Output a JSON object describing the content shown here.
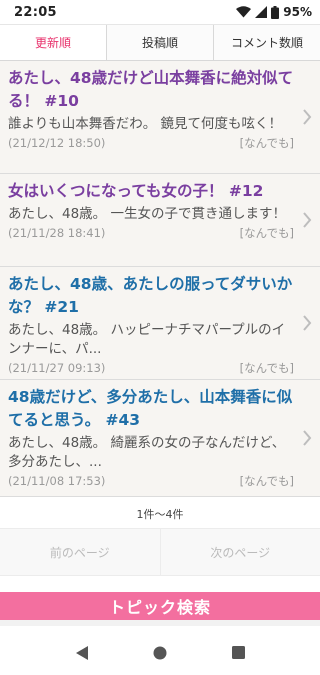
{
  "status": {
    "time": "22:05",
    "battery": "95%"
  },
  "tabs": [
    {
      "label": "更新順",
      "active": true
    },
    {
      "label": "投稿順",
      "active": false
    },
    {
      "label": "コメント数順",
      "active": false
    }
  ],
  "topics": [
    {
      "title": "あたし、48歳だけど山本舞香に絶対似てる！ #10",
      "excerpt": "誰よりも山本舞香だわ。 鏡見て何度も呟く！",
      "date": "(21/12/12 18:50)",
      "category": "[なんでも]"
    },
    {
      "title": "女はいくつになっても女の子！ #12",
      "excerpt": "あたし、48歳。 一生女の子で貫き通します！",
      "date": "(21/11/28 18:41)",
      "category": "[なんでも]"
    },
    {
      "title": "あたし、48歳、あたしの服ってダサいかな？ #21",
      "excerpt": "あたし、48歳。 ハッピーナチマパープルのインナーに、パ...",
      "date": "(21/11/27 09:13)",
      "category": "[なんでも]"
    },
    {
      "title": "48歳だけど、多分あたし、山本舞香に似てると思う。 #43",
      "excerpt": "あたし、48歳。 綺麗系の女の子なんだけど、多分あたし、...",
      "date": "(21/11/08 17:53)",
      "category": "[なんでも]"
    }
  ],
  "pagination": {
    "range": "1件～4件",
    "prev": "前のページ",
    "next": "次のページ"
  },
  "search": {
    "label": "トピック検索"
  },
  "colors": {
    "accent": "#e8336d",
    "purple_title": "#7a3fa0",
    "blue_title": "#1f6fa8",
    "search_bar": "#f36f9f"
  }
}
